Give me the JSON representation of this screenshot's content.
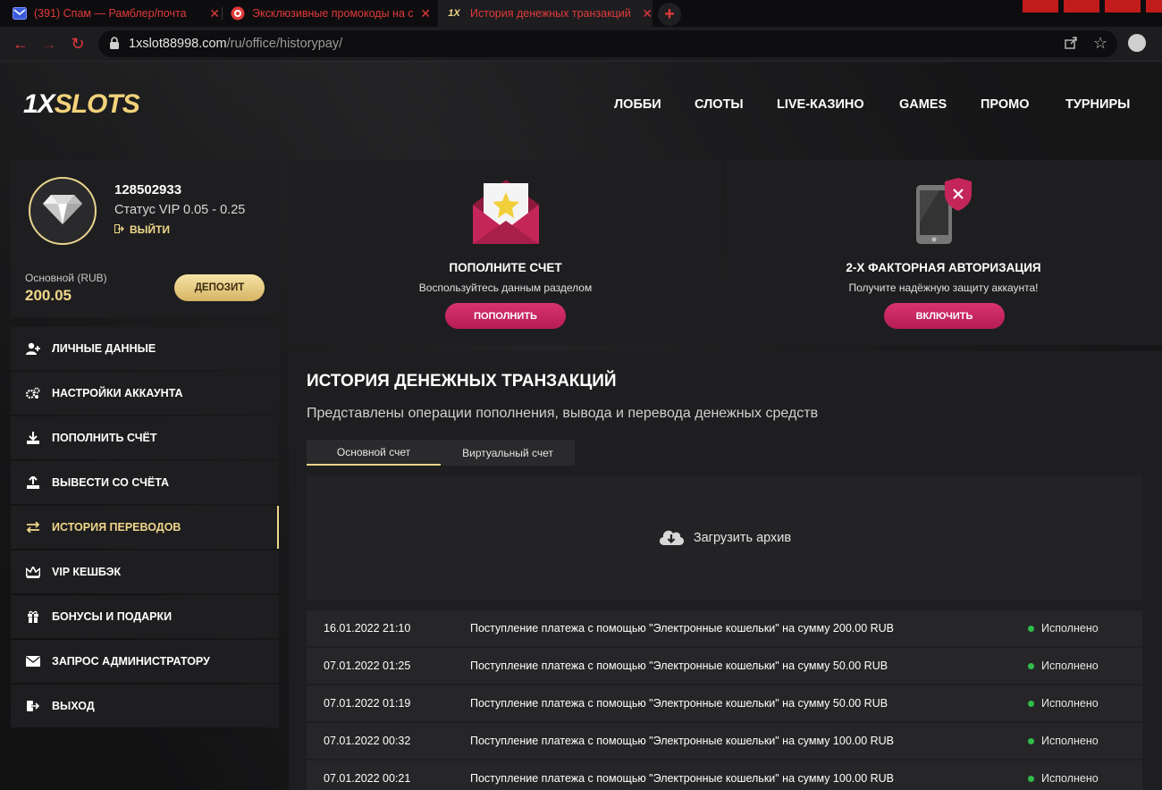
{
  "browser": {
    "tabs": [
      {
        "title": "(391) Спам — Рамблер/почта",
        "icon": "mail-icon"
      },
      {
        "title": "Эксклюзивные промокоды на с",
        "icon": "casino-chip-icon"
      },
      {
        "title": "История денежных транзакций",
        "icon": "site-favicon",
        "active": true
      }
    ],
    "url_host": "1xslot88998.com",
    "url_path": "/ru/office/historypay/"
  },
  "site": {
    "logo": {
      "x_part": "1X",
      "rest": "SLOTS"
    },
    "nav": [
      "ЛОББИ",
      "СЛОТЫ",
      "LIVE-КАЗИНО",
      "GAMES",
      "ПРОМО",
      "ТУРНИРЫ"
    ]
  },
  "profile": {
    "user_id": "128502933",
    "vip_status": "Статус VIP 0.05 - 0.25",
    "logout_label": "ВЫЙТИ",
    "account_label": "Основной (RUB)",
    "balance": "200.05",
    "deposit_label": "ДЕПОЗИТ"
  },
  "sidebar": {
    "items": [
      {
        "label": "ЛИЧНЫЕ ДАННЫЕ",
        "icon": "user-plus-icon"
      },
      {
        "label": "НАСТРОЙКИ АККАУНТА",
        "icon": "gears-icon"
      },
      {
        "label": "ПОПОЛНИТЬ СЧЁТ",
        "icon": "download-icon"
      },
      {
        "label": "ВЫВЕСТИ СО СЧЁТА",
        "icon": "upload-icon"
      },
      {
        "label": "ИСТОРИЯ ПЕРЕВОДОВ",
        "icon": "transfer-icon",
        "active": true
      },
      {
        "label": "VIP КЕШБЭК",
        "icon": "crown-icon"
      },
      {
        "label": "БОНУСЫ И ПОДАРКИ",
        "icon": "gift-icon"
      },
      {
        "label": "ЗАПРОС АДМИНИСТРАТОРУ",
        "icon": "envelope-icon"
      },
      {
        "label": "ВЫХОД",
        "icon": "exit-icon"
      }
    ]
  },
  "cards": {
    "deposit": {
      "title": "ПОПОЛНИТЕ СЧЕТ",
      "desc": "Воспользуйтесь данным разделом",
      "button": "ПОПОЛНИТЬ"
    },
    "twofa": {
      "title": "2-Х ФАКТОРНАЯ АВТОРИЗАЦИЯ",
      "desc": "Получите надёжную защиту аккаунта!",
      "button": "ВКЛЮЧИТЬ"
    }
  },
  "history": {
    "title": "ИСТОРИЯ ДЕНЕЖНЫХ ТРАНЗАКЦИЙ",
    "subtitle": "Представлены операции пополнения, вывода и перевода денежных средств",
    "tabs": [
      "Основной счет",
      "Виртуальный счет"
    ],
    "archive_label": "Загрузить архив",
    "rows": [
      {
        "date": "16.01.2022 21:10",
        "desc": "Поступление платежа с помощью \"Электронные кошельки\" на сумму 200.00 RUB",
        "status": "Исполнено"
      },
      {
        "date": "07.01.2022 01:25",
        "desc": "Поступление платежа с помощью \"Электронные кошельки\" на сумму 50.00 RUB",
        "status": "Исполнено"
      },
      {
        "date": "07.01.2022 01:19",
        "desc": "Поступление платежа с помощью \"Электронные кошельки\" на сумму 50.00 RUB",
        "status": "Исполнено"
      },
      {
        "date": "07.01.2022 00:32",
        "desc": "Поступление платежа с помощью \"Электронные кошельки\" на сумму 100.00 RUB",
        "status": "Исполнено"
      },
      {
        "date": "07.01.2022 00:21",
        "desc": "Поступление платежа с помощью \"Электронные кошельки\" на сумму 100.00 RUB",
        "status": "Исполнено"
      }
    ]
  },
  "colors": {
    "accent_gold": "#f0d78a",
    "accent_pink": "#c8275f",
    "status_green": "#2ebd4a",
    "browser_red": "#e23a3a"
  }
}
